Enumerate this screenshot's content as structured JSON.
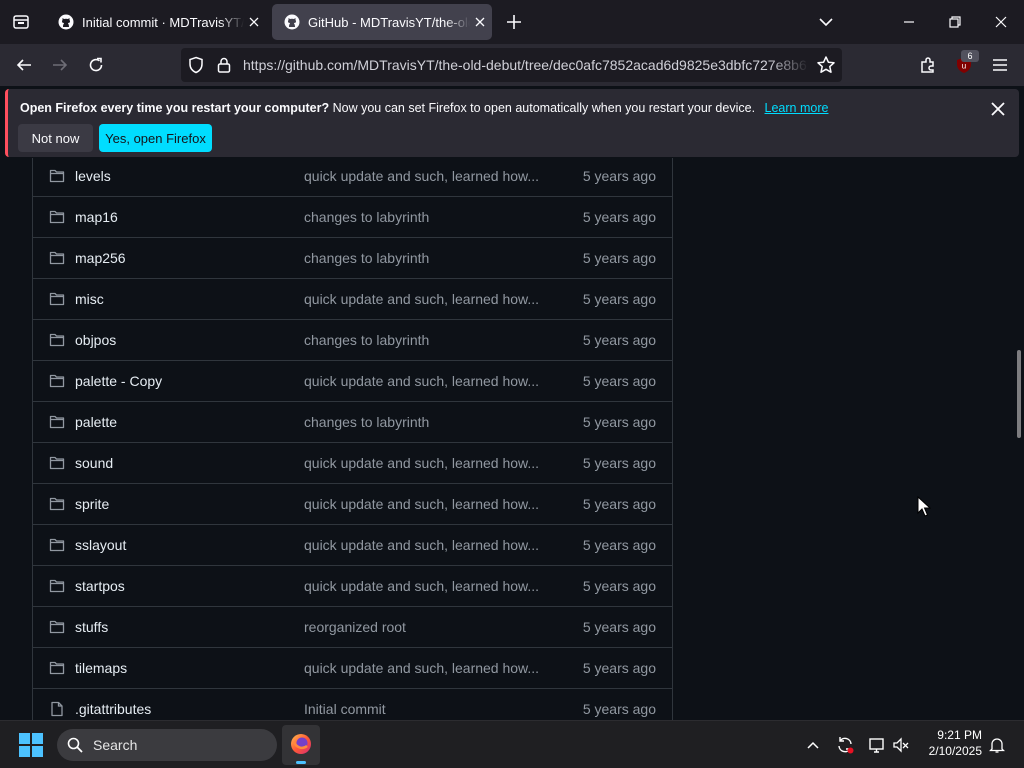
{
  "browser": {
    "tabs": [
      {
        "title": "Initial commit · MDTravisYT/the-old-debut",
        "active": false
      },
      {
        "title": "GitHub - MDTravisYT/the-old-debut",
        "active": true
      }
    ],
    "url": "https://github.com/MDTravisYT/the-old-debut/tree/dec0afc7852acad6d9825e3dbfc727e8b6",
    "extension_badge": "6"
  },
  "notification": {
    "title": "Open Firefox every time you restart your computer?",
    "message": "Now you can set Firefox to open automatically when you restart your device.",
    "learn_more": "Learn more",
    "not_now": "Not now",
    "yes_open": "Yes, open Firefox"
  },
  "files": [
    {
      "name": "levels",
      "type": "folder",
      "message": "quick update and such, learned how...",
      "age": "5 years ago"
    },
    {
      "name": "map16",
      "type": "folder",
      "message": "changes to labyrinth",
      "age": "5 years ago"
    },
    {
      "name": "map256",
      "type": "folder",
      "message": "changes to labyrinth",
      "age": "5 years ago"
    },
    {
      "name": "misc",
      "type": "folder",
      "message": "quick update and such, learned how...",
      "age": "5 years ago"
    },
    {
      "name": "objpos",
      "type": "folder",
      "message": "changes to labyrinth",
      "age": "5 years ago"
    },
    {
      "name": "palette - Copy",
      "type": "folder",
      "message": "quick update and such, learned how...",
      "age": "5 years ago"
    },
    {
      "name": "palette",
      "type": "folder",
      "message": "changes to labyrinth",
      "age": "5 years ago"
    },
    {
      "name": "sound",
      "type": "folder",
      "message": "quick update and such, learned how...",
      "age": "5 years ago"
    },
    {
      "name": "sprite",
      "type": "folder",
      "message": "quick update and such, learned how...",
      "age": "5 years ago"
    },
    {
      "name": "sslayout",
      "type": "folder",
      "message": "quick update and such, learned how...",
      "age": "5 years ago"
    },
    {
      "name": "startpos",
      "type": "folder",
      "message": "quick update and such, learned how...",
      "age": "5 years ago"
    },
    {
      "name": "stuffs",
      "type": "folder",
      "message": "reorganized root",
      "age": "5 years ago"
    },
    {
      "name": "tilemaps",
      "type": "folder",
      "message": "quick update and such, learned how...",
      "age": "5 years ago"
    },
    {
      "name": ".gitattributes",
      "type": "file",
      "message": "Initial commit",
      "age": "5 years ago"
    }
  ],
  "taskbar": {
    "search_label": "Search",
    "time": "9:21 PM",
    "date": "2/10/2025"
  },
  "colors": {
    "page_bg": "#0d1117",
    "border": "#30363d",
    "folder_icon": "#9198a1",
    "accent_button": "#00ddff",
    "notification_stripe": "#ff4f5e"
  }
}
